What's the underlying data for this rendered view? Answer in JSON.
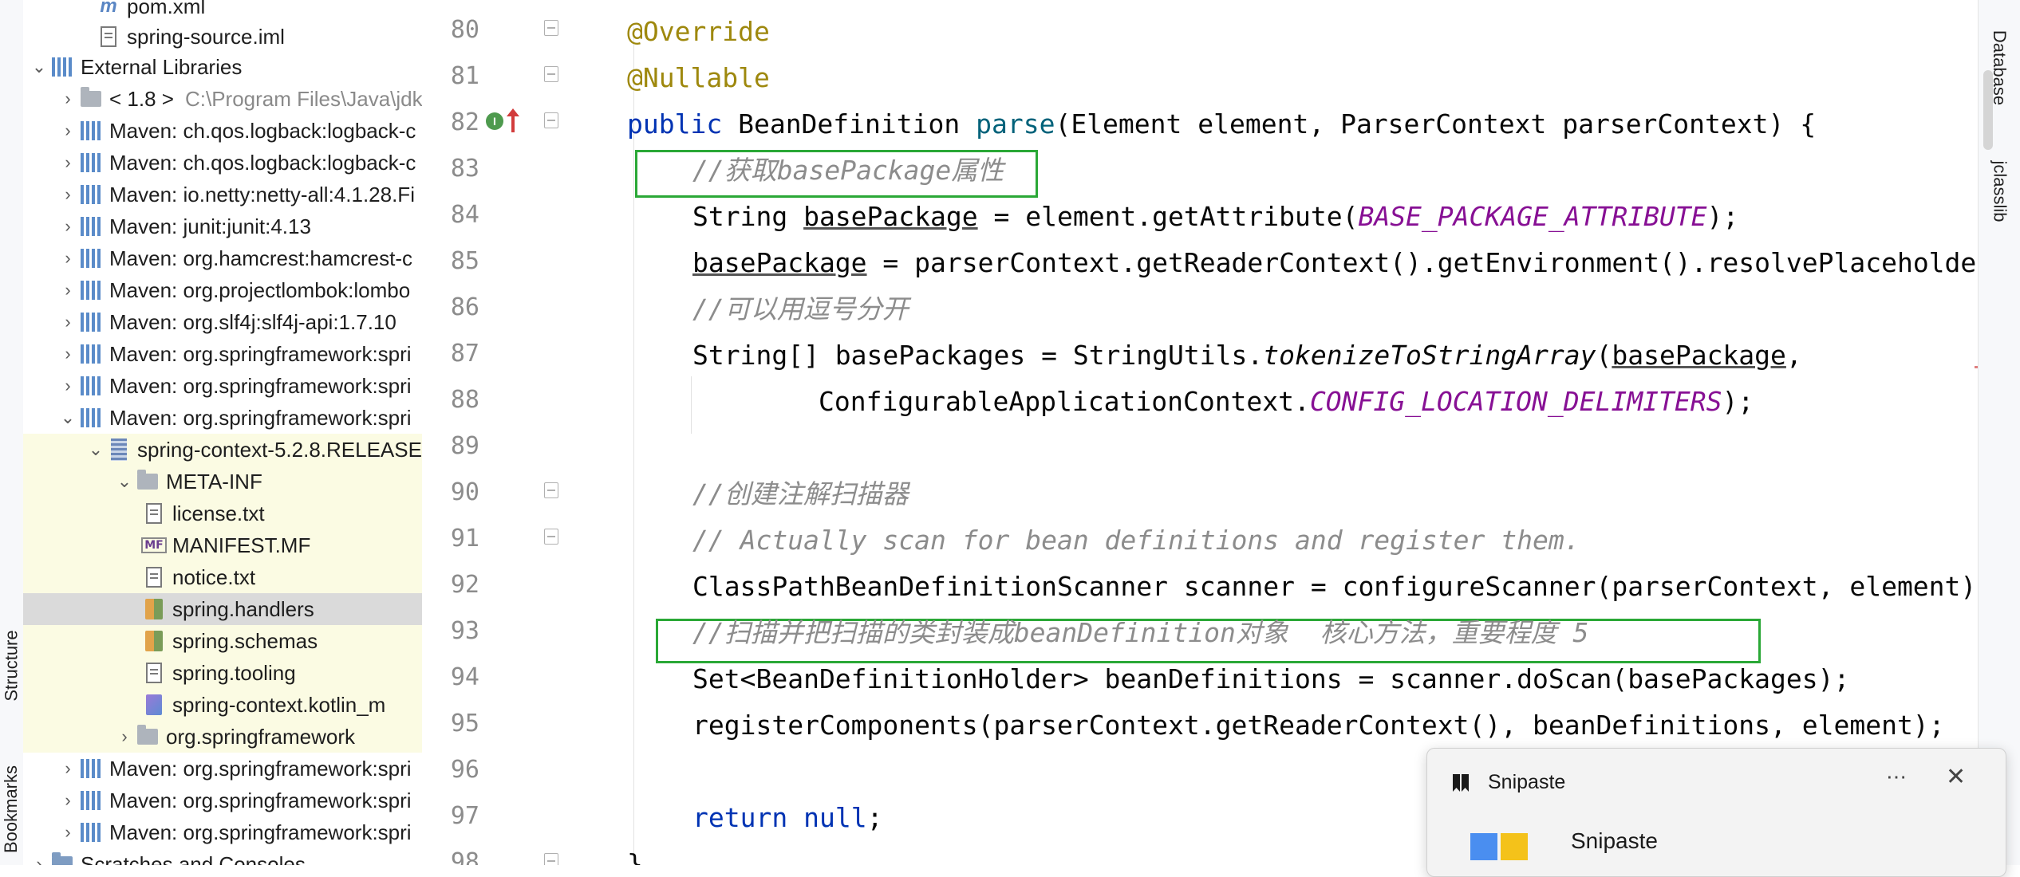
{
  "tool_strip_left": {
    "structure_label": "Structure",
    "bookmarks_label": "Bookmarks"
  },
  "tool_strip_right": {
    "database_label": "Database",
    "jclasslib_label": "jclasslib"
  },
  "project_tree": {
    "rows": [
      {
        "label": "pom.xml",
        "icon": "maven-file-icon",
        "hint": ""
      },
      {
        "label": "spring-source.iml",
        "icon": "module-file-icon",
        "hint": ""
      },
      {
        "label": "External Libraries",
        "icon": "library-icon",
        "hint": ""
      },
      {
        "label": "< 1.8 >",
        "icon": "folder-icon",
        "hint": "C:\\Program Files\\Java\\jdk"
      },
      {
        "label": "Maven: ch.qos.logback:logback-c",
        "icon": "library-icon",
        "hint": ""
      },
      {
        "label": "Maven: ch.qos.logback:logback-c",
        "icon": "library-icon",
        "hint": ""
      },
      {
        "label": "Maven: io.netty:netty-all:4.1.28.Fi",
        "icon": "library-icon",
        "hint": ""
      },
      {
        "label": "Maven: junit:junit:4.13",
        "icon": "library-icon",
        "hint": ""
      },
      {
        "label": "Maven: org.hamcrest:hamcrest-c",
        "icon": "library-icon",
        "hint": ""
      },
      {
        "label": "Maven: org.projectlombok:lombo",
        "icon": "library-icon",
        "hint": ""
      },
      {
        "label": "Maven: org.slf4j:slf4j-api:1.7.10",
        "icon": "library-icon",
        "hint": ""
      },
      {
        "label": "Maven: org.springframework:spri",
        "icon": "library-icon",
        "hint": ""
      },
      {
        "label": "Maven: org.springframework:spri",
        "icon": "library-icon",
        "hint": ""
      },
      {
        "label": "Maven: org.springframework:spri",
        "icon": "library-icon",
        "hint": ""
      },
      {
        "label": "spring-context-5.2.8.RELEASE.",
        "icon": "jar-icon",
        "hint": ""
      },
      {
        "label": "META-INF",
        "icon": "folder-icon",
        "hint": ""
      },
      {
        "label": "license.txt",
        "icon": "text-file-icon",
        "hint": ""
      },
      {
        "label": "MANIFEST.MF",
        "icon": "manifest-icon",
        "hint": ""
      },
      {
        "label": "notice.txt",
        "icon": "text-file-icon",
        "hint": ""
      },
      {
        "label": "spring.handlers",
        "icon": "properties-file-icon",
        "hint": ""
      },
      {
        "label": "spring.schemas",
        "icon": "properties-file-icon",
        "hint": ""
      },
      {
        "label": "spring.tooling",
        "icon": "text-file-icon",
        "hint": ""
      },
      {
        "label": "spring-context.kotlin_m",
        "icon": "kotlin-file-icon",
        "hint": ""
      },
      {
        "label": "org.springframework",
        "icon": "package-icon",
        "hint": ""
      },
      {
        "label": "Maven: org.springframework:spri",
        "icon": "library-icon",
        "hint": ""
      },
      {
        "label": "Maven: org.springframework:spri",
        "icon": "library-icon",
        "hint": ""
      },
      {
        "label": "Maven: org.springframework:spri",
        "icon": "library-icon",
        "hint": ""
      },
      {
        "label": "Scratches and Consoles",
        "icon": "scratches-icon",
        "hint": ""
      }
    ]
  },
  "editor": {
    "line_numbers": [
      "80",
      "81",
      "82",
      "83",
      "84",
      "85",
      "86",
      "87",
      "88",
      "89",
      "90",
      "91",
      "92",
      "93",
      "94",
      "95",
      "96",
      "97",
      "98"
    ],
    "code": {
      "l80": {
        "a": "@Override"
      },
      "l81": {
        "a": "@Nullable"
      },
      "l82": {
        "kw": "public",
        "t1": " BeanDefinition ",
        "fn": "parse",
        "t2": "(Element element, ParserContext parserContext) {"
      },
      "l83": {
        "c": "//获取basePackage属性"
      },
      "l84": {
        "t1": "String ",
        "u1": "basePackage",
        "t2": " = element.getAttribute(",
        "k1": "BASE_PACKAGE_ATTRIBUTE",
        "t3": ");"
      },
      "l85": {
        "u1": "basePackage",
        "t1": " = parserContext.getReaderContext().getEnvironment().resolvePlaceholder"
      },
      "l86": {
        "c": "//可以用逗号分开"
      },
      "l87": {
        "t1": "String[] basePackages = StringUtils.",
        "s1": "tokenizeToStringArray",
        "t2": "(",
        "u1": "basePackage",
        "t3": ","
      },
      "l88": {
        "t1": "ConfigurableApplicationContext.",
        "k1": "CONFIG_LOCATION_DELIMITERS",
        "t2": ");"
      },
      "l90": {
        "c": "//创建注解扫描器"
      },
      "l91": {
        "c": "// Actually scan for bean definitions and register them."
      },
      "l92": {
        "t1": "ClassPathBeanDefinitionScanner scanner = configureScanner(parserContext, element);"
      },
      "l93": {
        "c": "//扫描并把扫描的类封装成beanDefinition对象  核心方法，重要程度 5"
      },
      "l94": {
        "t1": "Set<BeanDefinitionHolder> beanDefinitions = scanner.doScan(basePackages);"
      },
      "l95": {
        "t1": "registerComponents(parserContext.getReaderContext(), beanDefinitions, element);"
      },
      "l97": {
        "kw": "return",
        "t1": " ",
        "kw2": "null",
        "t2": ";"
      },
      "l98": {
        "t1": "}"
      }
    },
    "gutter_badges": {
      "implements_badge": "I"
    }
  },
  "notification": {
    "app_name": "Snipaste",
    "more_icon": "⋯",
    "close_icon": "✕",
    "heading": "Snipaste"
  },
  "colors": {
    "highlight_box": "#2aa836",
    "keyword": "#0033b3",
    "annotation": "#9e880d",
    "method": "#00627a",
    "comment": "#8c8c8c",
    "constant": "#871094"
  }
}
